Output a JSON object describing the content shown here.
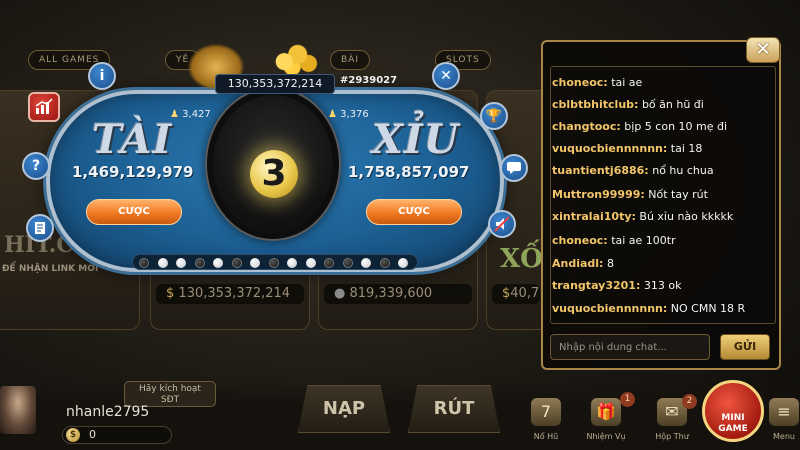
{
  "lobby": {
    "tabs": [
      "ALL GAMES",
      "YÊ",
      "BÀI",
      "SLOTS"
    ],
    "left_logo": "HIT.C",
    "left_sub": "ĐỂ NHẬN LINK MỚI",
    "right_logo": "XỐ",
    "card_amounts": [
      {
        "icon": "$",
        "value": "130,353,372,214"
      },
      {
        "icon": "●",
        "value": "819,339,600"
      },
      {
        "icon": "$",
        "value": "40,7"
      }
    ]
  },
  "taixiu": {
    "jackpot": "130,353,372,214",
    "session": "#2939027",
    "timer": "3",
    "tai": {
      "label": "TÀI",
      "players": "3,427",
      "amount": "1,469,129,979",
      "bet": "CƯỢC"
    },
    "xiu": {
      "label": "XỈU",
      "players": "3,376",
      "amount": "1,758,857,097",
      "bet": "CƯỢC"
    },
    "history": [
      "b",
      "w",
      "w",
      "b",
      "w",
      "b",
      "w",
      "b",
      "w",
      "w",
      "b",
      "b",
      "w",
      "b",
      "w",
      "b",
      "w",
      "b",
      "w",
      "b",
      "w",
      "w",
      "w",
      "w",
      "w",
      "w"
    ],
    "side_buttons": {
      "info": "i",
      "close": "✕",
      "stats": "chart-icon",
      "help": "?",
      "trophy": "trophy-icon",
      "rules": "rules-icon",
      "chat": "chat-icon",
      "sound": "sound-off-icon"
    }
  },
  "chat": {
    "messages": [
      {
        "user": "choneoc:",
        "text": "tai ae"
      },
      {
        "user": "cblbtbhitclub:",
        "text": "bố ăn hũ đi"
      },
      {
        "user": "changtooc:",
        "text": "bịp 5 con 10 mẹ đi"
      },
      {
        "user": "vuquocbiennnnnn:",
        "text": "tai 18"
      },
      {
        "user": "tuantientj6886:",
        "text": "nổ hu chua"
      },
      {
        "user": "Muttron99999:",
        "text": "Nốt tay rút"
      },
      {
        "user": "xintralai10ty:",
        "text": "Bú xỉu nào kkkkk"
      },
      {
        "user": "choneoc:",
        "text": "tai ae 100tr"
      },
      {
        "user": "Andiadl:",
        "text": "8"
      },
      {
        "user": "trangtay3201:",
        "text": "313 ok"
      },
      {
        "user": "vuquocbiennnnnn:",
        "text": "NO CMN 18 R"
      }
    ],
    "placeholder": "Nhập nội dung chat...",
    "send": "GỬI",
    "close": "✕"
  },
  "user": {
    "name": "nhanle2795",
    "balance": "0",
    "currency_icon": "$",
    "activate_line1": "Hãy kích hoạt",
    "activate_line2": "SĐT"
  },
  "nav": {
    "deposit": "NẠP",
    "withdraw": "RÚT",
    "dock": [
      {
        "label": "Nổ Hũ",
        "icon": "slot-icon",
        "badge": ""
      },
      {
        "label": "Nhiệm Vụ",
        "icon": "gift-icon",
        "badge": "1"
      },
      {
        "label": "Hộp Thư",
        "icon": "mail-icon",
        "badge": "2"
      },
      {
        "label": "Menu",
        "icon": "menu-icon",
        "badge": ""
      }
    ],
    "mini_game_line1": "MINI",
    "mini_game_line2": "GAME"
  },
  "colors": {
    "accent_gold": "#f3c56a",
    "panel_blue": "#1c5f93",
    "bet_orange": "#f07a22",
    "mini_red": "#d33a2a"
  }
}
